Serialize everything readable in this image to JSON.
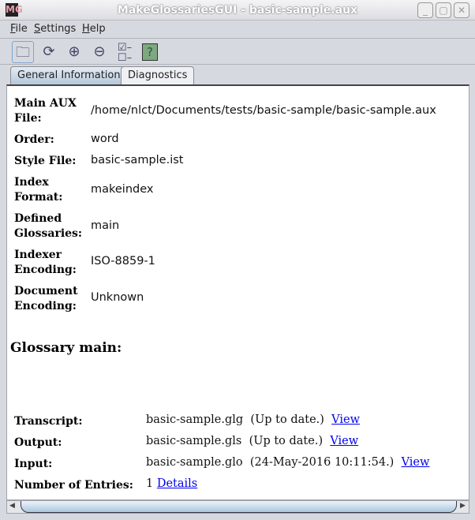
{
  "window": {
    "title": "MakeGlossariesGUI - basic-sample.aux",
    "icon": "MG",
    "controls": [
      "minimize",
      "maximize",
      "close"
    ]
  },
  "menu": [
    {
      "label": "File",
      "mnemonic": "F",
      "rest": "ile"
    },
    {
      "label": "Settings",
      "mnemonic": "S",
      "rest": "ettings"
    },
    {
      "label": "Help",
      "mnemonic": "H",
      "rest": "elp"
    }
  ],
  "toolbar": {
    "icons": [
      "open-folder-icon",
      "reload-icon",
      "zoom-in-icon",
      "zoom-out-icon",
      "checklist-icon",
      "help-icon"
    ]
  },
  "tabs": [
    {
      "label": "General Information",
      "selected": true
    },
    {
      "label": "Diagnostics",
      "selected": false
    }
  ],
  "general": [
    {
      "label_l1": "Main AUX",
      "label_l2": "File:",
      "value": "/home/nlct/Documents/tests/basic-sample/basic-sample.aux"
    },
    {
      "label_l1": "Order:",
      "value": "word"
    },
    {
      "label_l1": "Style File:",
      "value": "basic-sample.ist"
    },
    {
      "label_l1": "Index",
      "label_l2": "Format:",
      "value": "makeindex"
    },
    {
      "label_l1": "Defined",
      "label_l2": "Glossaries:",
      "value": "main"
    },
    {
      "label_l1": "Indexer",
      "label_l2": "Encoding:",
      "value": "ISO-8859-1"
    },
    {
      "label_l1": "Document",
      "label_l2": "Encoding:",
      "value": "Unknown"
    }
  ],
  "glossary": {
    "heading": "Glossary main:",
    "rows": [
      {
        "label": "Transcript:",
        "file": "basic-sample.glg",
        "status": "(Up to date.)",
        "link": "View"
      },
      {
        "label": "Output:",
        "file": "basic-sample.gls",
        "status": "(Up to date.)",
        "link": "View"
      },
      {
        "label": "Input:",
        "file": "basic-sample.glo",
        "status": "(24-May-2016 10:11:54.)",
        "link": "View"
      }
    ],
    "entries": {
      "label": "Number of Entries:",
      "count": "1",
      "link": "Details"
    }
  }
}
